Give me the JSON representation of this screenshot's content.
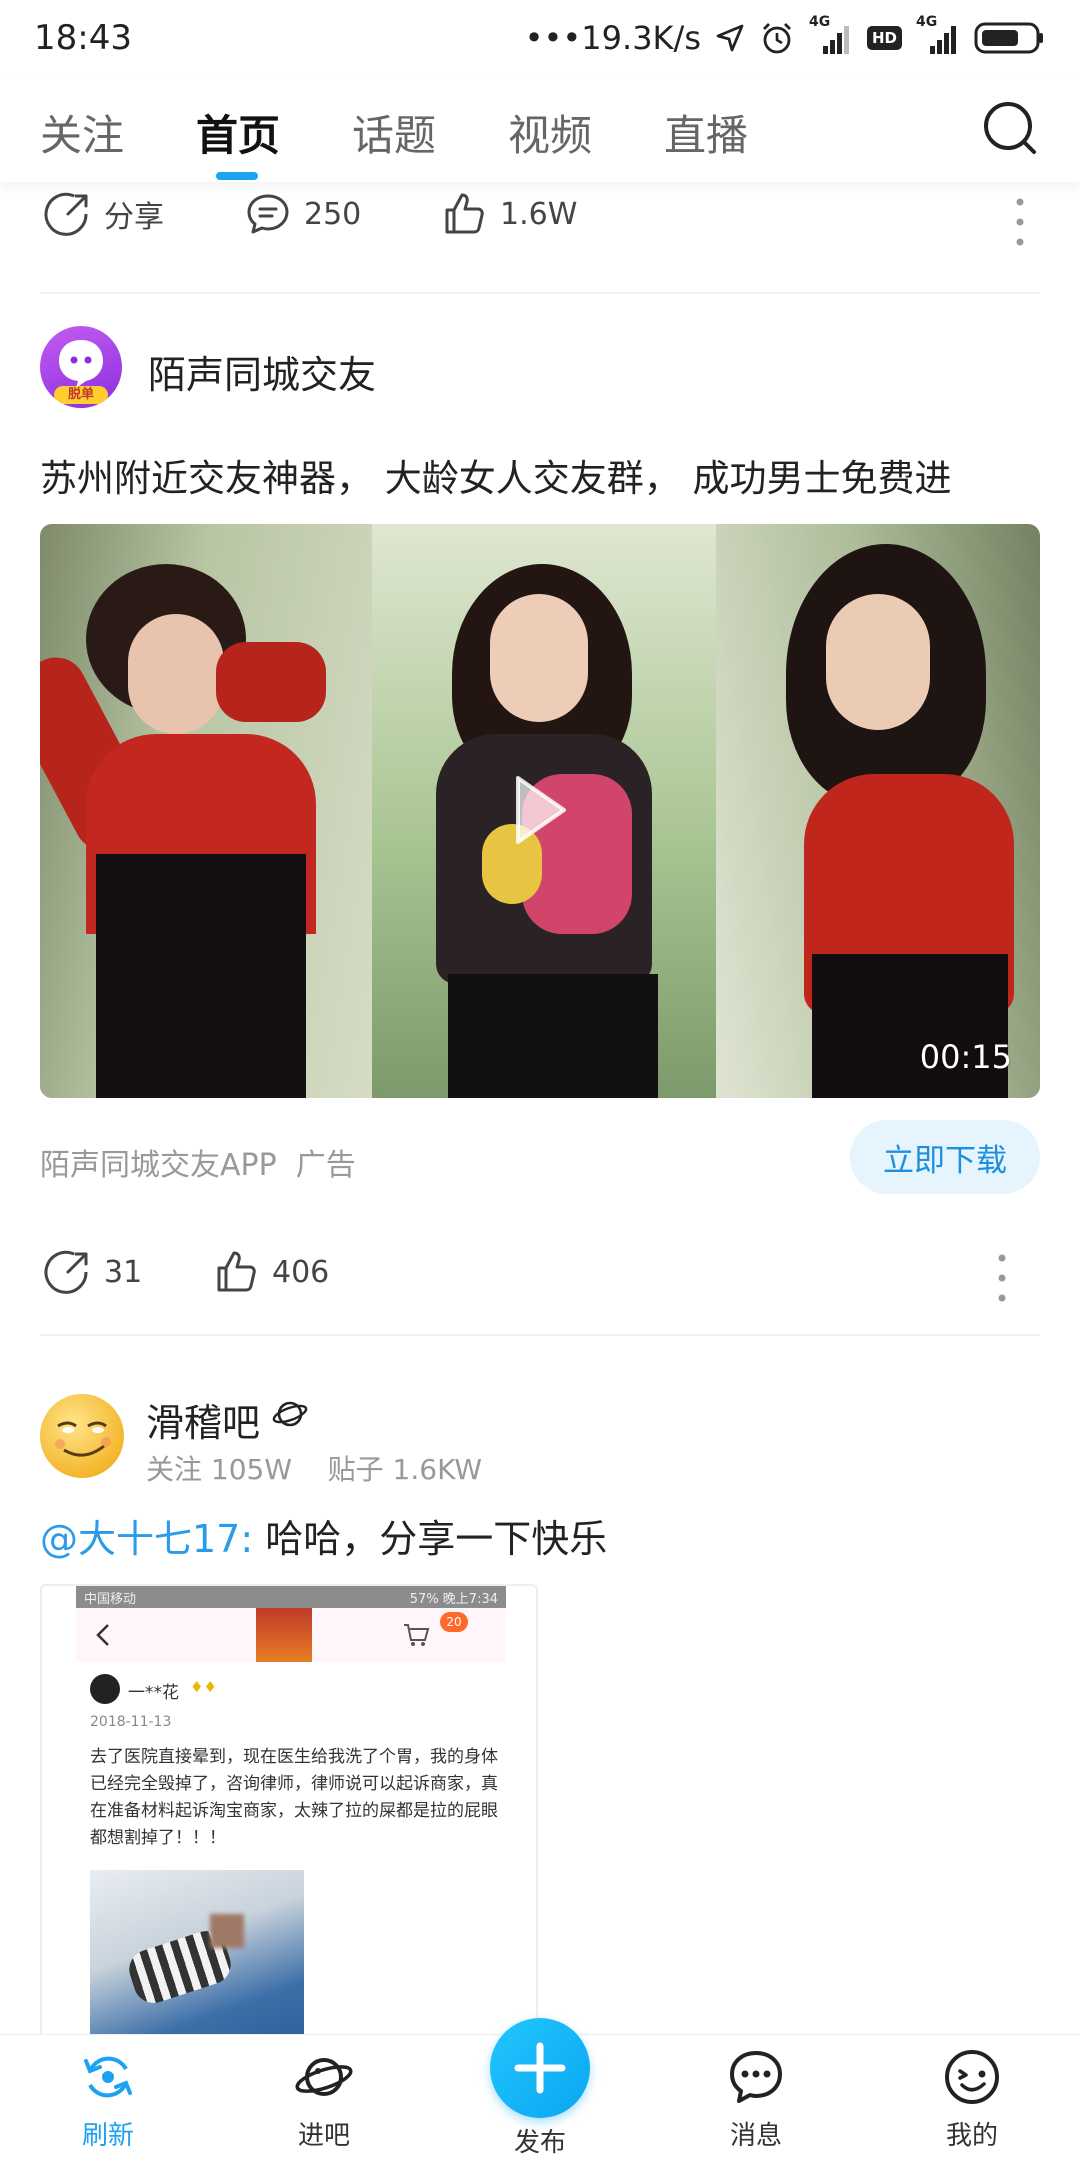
{
  "status_bar": {
    "time": "18:43",
    "net_speed": "19.3K/s",
    "battery": "",
    "sim1": "4G",
    "sim2": "4G",
    "hd": "HD"
  },
  "top_nav": {
    "tabs": [
      {
        "label": "关注"
      },
      {
        "label": "首页",
        "active": true
      },
      {
        "label": "话题"
      },
      {
        "label": "视频"
      },
      {
        "label": "直播"
      }
    ]
  },
  "prev_post": {
    "share_label": "分享",
    "comments": "250",
    "likes": "1.6W"
  },
  "ad_post": {
    "author": "陌声同城交友",
    "avatar_badge": "脱单",
    "text": "苏州附近交友神器， 大龄女人交友群， 成功男士免费进",
    "duration": "00:15",
    "source": "陌声同城交友APP",
    "ad_tag": "广告",
    "download_label": "立即下载",
    "shares": "31",
    "likes": "406"
  },
  "forum_post": {
    "forum_name": "滑稽吧",
    "followers": "关注 105W",
    "posts": "贴子 1.6KW",
    "mention": "@大十七17:",
    "text": " 哈哈，分享一下快乐",
    "embedded": {
      "carrier": "中国移动",
      "status_right": "57% 晚上7:34",
      "cart_badge": "20",
      "user": "一**花",
      "date": "2018-11-13",
      "body": "去了医院直接晕到，现在医生给我洗了个胃，我的身体已经完全毁掉了，咨询律师，律师说可以起诉商家，真在准备材料起诉淘宝商家，太辣了拉的屎都是拉的屁眼都想割掉了！！！"
    }
  },
  "bottom_nav": {
    "items": [
      {
        "label": "刷新",
        "icon": "refresh-icon",
        "active": true
      },
      {
        "label": "进吧",
        "icon": "planet-icon"
      },
      {
        "label": "发布",
        "icon": "plus-icon"
      },
      {
        "label": "消息",
        "icon": "message-icon"
      },
      {
        "label": "我的",
        "icon": "wink-face-icon"
      }
    ]
  },
  "colors": {
    "accent": "#1da1f2",
    "link": "#2a9be8",
    "download_bg": "#e6f4fd"
  }
}
